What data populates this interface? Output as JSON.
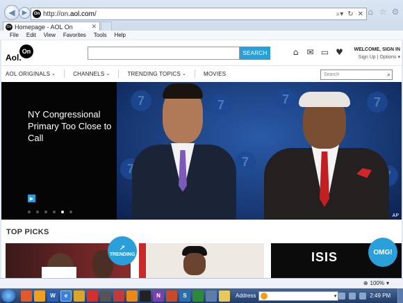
{
  "browser": {
    "url_prefix": "http://on.",
    "url_domain": "aol.com",
    "url_suffix": "/",
    "tab_title": "Homepage - AOL On",
    "menu": [
      "File",
      "Edit",
      "View",
      "Favorites",
      "Tools",
      "Help"
    ],
    "zoom": "100%"
  },
  "header": {
    "logo_text": "Aol.",
    "logo_circle": "On",
    "search_button": "SEARCH",
    "welcome": "WELCOME, SIGN IN",
    "signup": "Sign Up",
    "options": "Options"
  },
  "nav": {
    "items": [
      "AOL ORIGINALS",
      "CHANNELS",
      "TRENDING TOPICS",
      "MOVIES"
    ],
    "search_placeholder": "Search"
  },
  "hero": {
    "title": "NY Congressional Primary Too Close to Call",
    "credit": "AP",
    "slide_count": 6,
    "active_slide": 5
  },
  "top_picks": {
    "heading": "TOP PICKS",
    "badge_trending": "TRENDING",
    "badge_omg": "OMG!",
    "thumb_text": "ISIS"
  },
  "taskbar": {
    "address_label": "Address",
    "time": "2:49 PM"
  }
}
